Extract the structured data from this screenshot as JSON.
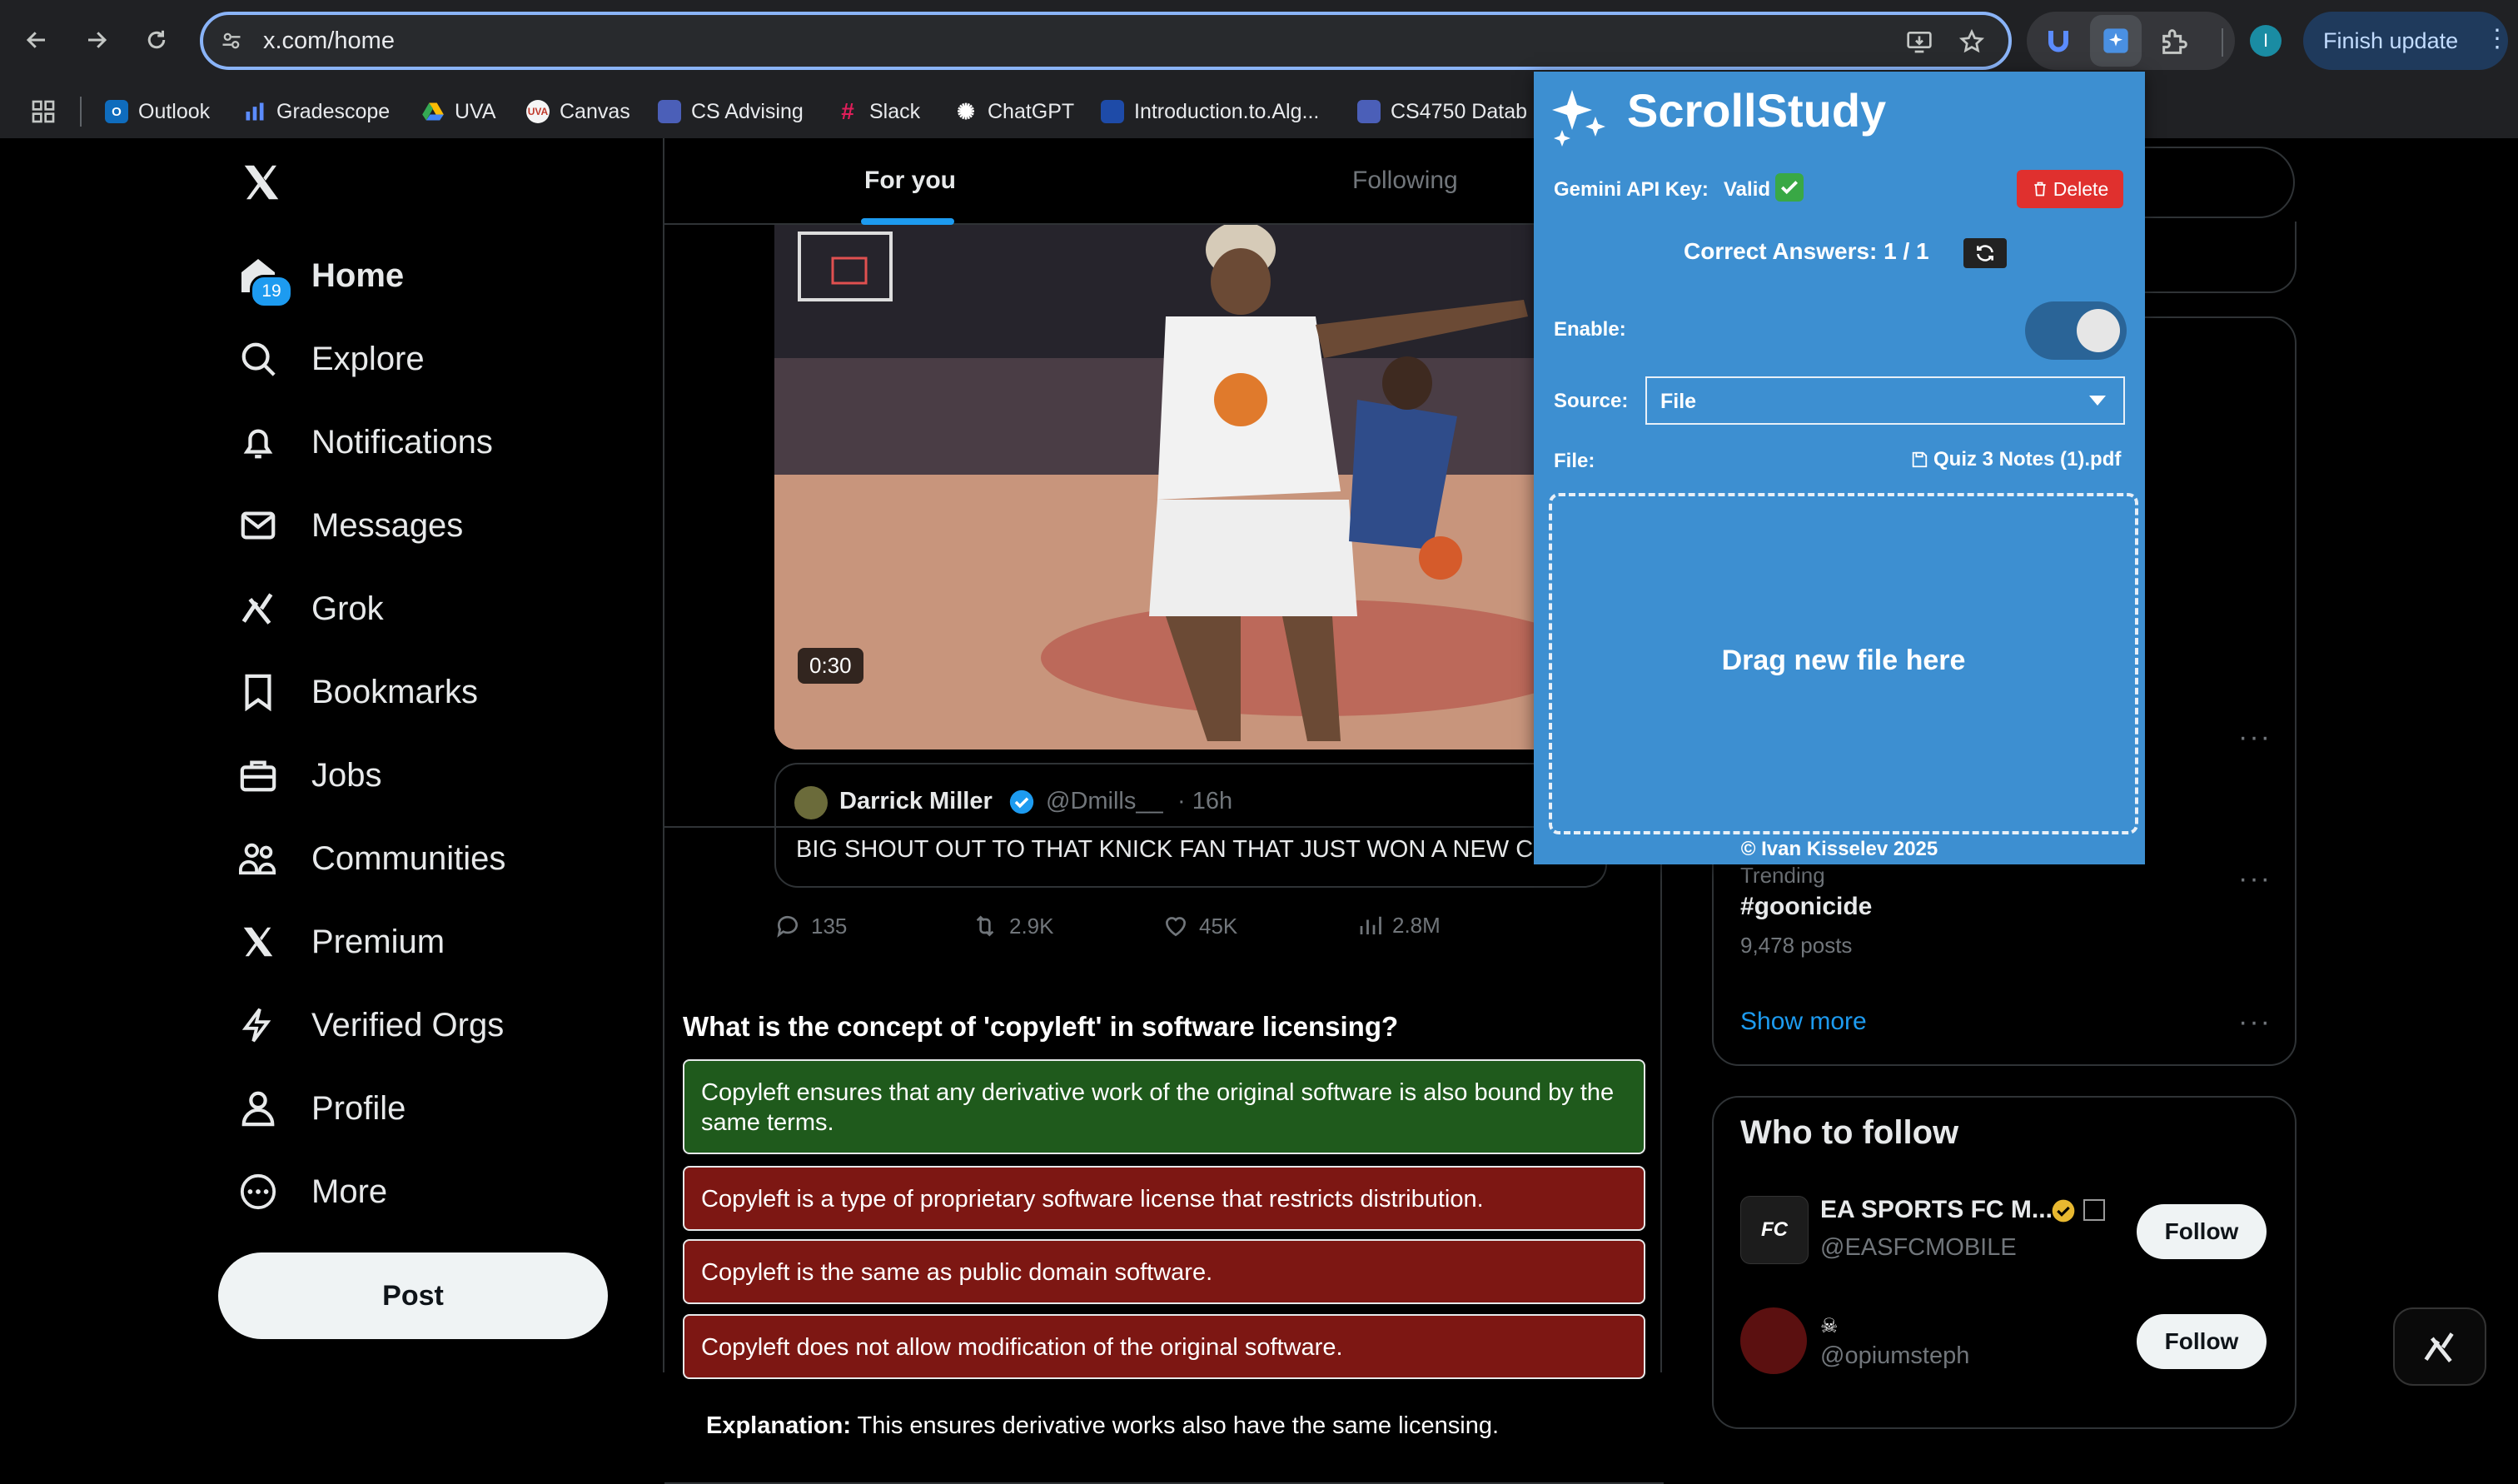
{
  "browser": {
    "url": "x.com/home",
    "finish_update": "Finish update",
    "profile_initial": "I",
    "bookmarks": [
      {
        "label": "Outlook",
        "icon": "outlook-icon",
        "color": "#0f6cbd"
      },
      {
        "label": "Gradescope",
        "icon": "gradescope-icon",
        "color": "#2a6ab1"
      },
      {
        "label": "UVA",
        "icon": "drive-icon",
        "color": "#34a853"
      },
      {
        "label": "Canvas",
        "icon": "canvas-icon",
        "color": "#f5f5f5"
      },
      {
        "label": "CS Advising",
        "icon": "folder-icon",
        "color": "#4b5fb8"
      },
      {
        "label": "Slack",
        "icon": "slack-icon",
        "color": "#e01e5a"
      },
      {
        "label": "ChatGPT",
        "icon": "chatgpt-icon",
        "color": "#ffffff"
      },
      {
        "label": "Introduction.to.Alg...",
        "icon": "book-icon",
        "color": "#1e4ba8"
      },
      {
        "label": "CS4750 Datab",
        "icon": "folder-icon",
        "color": "#4b5fb8"
      }
    ]
  },
  "nav": {
    "items": [
      {
        "label": "Home",
        "icon": "home-icon"
      },
      {
        "label": "Explore",
        "icon": "search-icon"
      },
      {
        "label": "Notifications",
        "icon": "bell-icon"
      },
      {
        "label": "Messages",
        "icon": "mail-icon"
      },
      {
        "label": "Grok",
        "icon": "grok-icon"
      },
      {
        "label": "Bookmarks",
        "icon": "bookmark-icon"
      },
      {
        "label": "Jobs",
        "icon": "briefcase-icon"
      },
      {
        "label": "Communities",
        "icon": "people-icon"
      },
      {
        "label": "Premium",
        "icon": "x-logo-icon"
      },
      {
        "label": "Verified Orgs",
        "icon": "lightning-icon"
      },
      {
        "label": "Profile",
        "icon": "person-icon"
      },
      {
        "label": "More",
        "icon": "more-circle-icon"
      }
    ],
    "notifications_badge": "19",
    "post_label": "Post"
  },
  "timeline": {
    "tabs": [
      "For you",
      "Following"
    ],
    "video_duration": "0:30",
    "quoted": {
      "name": "Darrick Miller",
      "handle": "@Dmills__",
      "time": "· 16h",
      "text": "BIG SHOUT OUT TO THAT KNICK FAN THAT JUST WON A NEW C"
    },
    "metrics": {
      "replies": "135",
      "reposts": "2.9K",
      "likes": "45K",
      "views": "2.8M"
    },
    "quiz": {
      "question": "What is the concept of 'copyleft' in software licensing?",
      "answers": [
        {
          "text": "Copyleft ensures that any derivative work of the original software is also bound by the same terms.",
          "correct": true
        },
        {
          "text": "Copyleft is a type of proprietary software license that restricts distribution.",
          "correct": false
        },
        {
          "text": "Copyleft is the same as public domain software.",
          "correct": false
        },
        {
          "text": "Copyleft does not allow modification of the original software.",
          "correct": false
        }
      ],
      "explanation_label": "Explanation:",
      "explanation_text": " This ensures derivative works also have the same licensing."
    },
    "colors": {
      "correct": "#1f5a1c",
      "wrong": "#7d1713"
    }
  },
  "sidebar": {
    "trending_label": "Trending",
    "trend": "#goonicide",
    "trend_posts": "9,478 posts",
    "show_more": "Show more",
    "who_to_follow": "Who to follow",
    "accounts": [
      {
        "name": "EA SPORTS FC M...",
        "handle": "@EASFCMOBILE",
        "follow": "Follow"
      },
      {
        "name": "",
        "handle": "@opiumsteph",
        "follow": "Follow"
      }
    ]
  },
  "scrollstudy": {
    "title": "ScrollStudy",
    "api_key_label": "Gemini API Key:",
    "api_key_status": "Valid",
    "delete_label": "Delete",
    "correct_answers": "Correct Answers: 1 / 1",
    "enable_label": "Enable:",
    "enabled": true,
    "source_label": "Source:",
    "source_value": "File",
    "file_label": "File:",
    "file_name": "Quiz 3 Notes (1).pdf",
    "drop_text": "Drag new file here",
    "copyright": "© Ivan Kisselev 2025"
  }
}
